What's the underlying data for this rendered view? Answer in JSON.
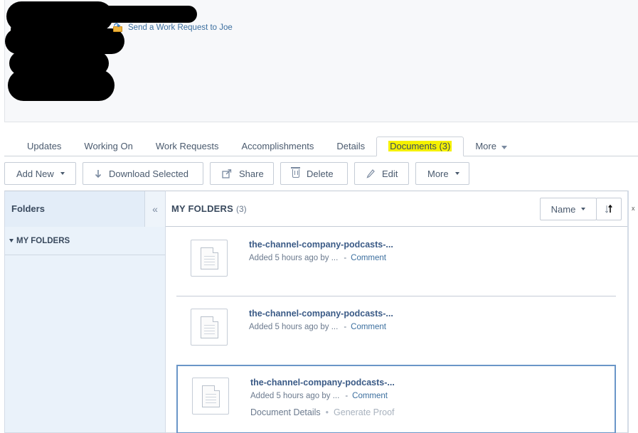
{
  "header": {
    "work_request_link": "Send a Work Request to Joe",
    "work_request_icon": "folder-arrow-icon"
  },
  "tabs": [
    {
      "label": "Updates"
    },
    {
      "label": "Working On"
    },
    {
      "label": "Work Requests"
    },
    {
      "label": "Accomplishments"
    },
    {
      "label": "Details"
    },
    {
      "label": "Documents (3)",
      "active": true
    },
    {
      "label": "More"
    }
  ],
  "toolbar": {
    "add_new": "Add New",
    "download_selected": "Download Selected",
    "share": "Share",
    "delete": "Delete",
    "edit": "Edit",
    "more": "More"
  },
  "sidebar": {
    "title": "Folders",
    "collapse_glyph": "«",
    "folder": "MY FOLDERS"
  },
  "main": {
    "title": "MY FOLDERS",
    "count": "(3)",
    "sort_label": "Name"
  },
  "documents": [
    {
      "title": "the-channel-company-podcasts-...",
      "meta": "Added 5 hours ago by ...",
      "dash": "-",
      "comment": "Comment"
    },
    {
      "title": "the-channel-company-podcasts-...",
      "meta": "Added 5 hours ago by ...",
      "dash": "-",
      "comment": "Comment"
    },
    {
      "title": "the-channel-company-podcasts-...",
      "meta": "Added 5 hours ago by ...",
      "dash": "-",
      "comment": "Comment",
      "details": "Document Details",
      "proof": "Generate Proof"
    }
  ],
  "edge_glyph": "x",
  "colors": {
    "link": "#3c6f9f",
    "highlight": "#f5f100",
    "selected_border": "#6a96c8",
    "sidebar_bg": "#eaf2fa"
  }
}
